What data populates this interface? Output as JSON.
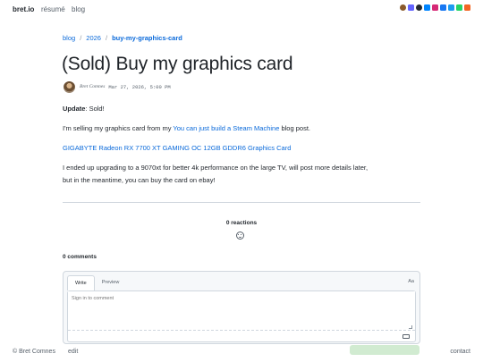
{
  "nav": {
    "brand": "bret.io",
    "links": [
      "résumé",
      "blog"
    ],
    "social_icons": [
      {
        "name": "avatar-icon",
        "color": "#8a5a2b"
      },
      {
        "name": "mastodon-icon",
        "color": "#6364ff"
      },
      {
        "name": "github-icon",
        "color": "#24292f"
      },
      {
        "name": "bluesky-icon",
        "color": "#0085ff"
      },
      {
        "name": "instagram-icon",
        "color": "#d62976"
      },
      {
        "name": "facebook-icon",
        "color": "#1877f2"
      },
      {
        "name": "twitter-icon",
        "color": "#1d9bf0"
      },
      {
        "name": "phone-icon",
        "color": "#25d366"
      },
      {
        "name": "rss-icon",
        "color": "#f26522"
      }
    ]
  },
  "breadcrumb": {
    "items": [
      "blog",
      "2026",
      "buy-my-graphics-card"
    ],
    "separator": "/"
  },
  "post": {
    "title": "(Sold) Buy my graphics card",
    "author": "Bret Comnes",
    "date": "Mar 27, 2026, 5:00 PM",
    "update_label": "Update",
    "update_text": ": Sold!",
    "p1_before": "I'm selling my graphics card from my ",
    "p1_link": "You can just build a Steam Machine",
    "p1_after": " blog post.",
    "product_link": "GIGABYTE Radeon RX 7700 XT GAMING OC 12GB GDDR6 Graphics Card",
    "p2_line1": "I ended up upgrading to a 9070xt for better 4k performance on the large TV, will post more details later,",
    "p2_line2": "but in the meantime, you can buy the card on ebay!"
  },
  "comments": {
    "reactions_label": "0 reactions",
    "count_label": "0 comments",
    "tabs": [
      "Write",
      "Preview"
    ],
    "format_label": "Aa",
    "placeholder": "Sign in to comment"
  },
  "footer": {
    "copyright": "© Bret Comnes",
    "edit": "edit",
    "contact": "contact"
  }
}
